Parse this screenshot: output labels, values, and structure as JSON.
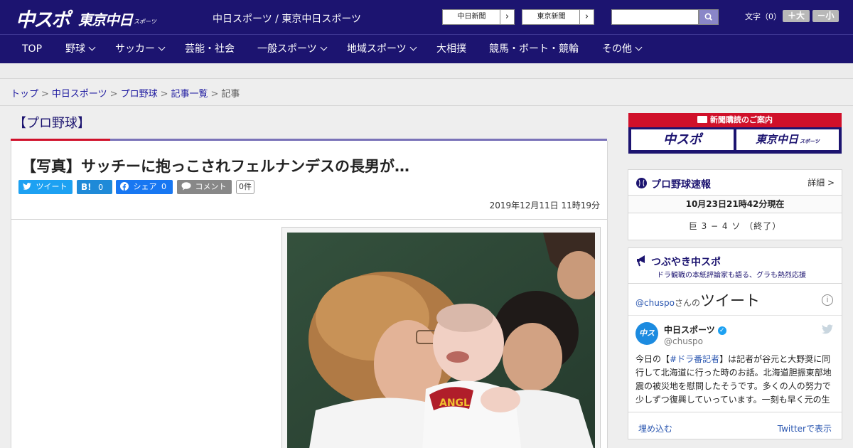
{
  "header": {
    "logo_chuspo": "中スポ",
    "logo_tokyo": "東京中日",
    "logo_tokyo_sub": "スポーツ",
    "site_name": "中日スポーツ / 東京中日スポーツ",
    "paper_links": [
      {
        "label": "中日新聞",
        "arrow": "›"
      },
      {
        "label": "東京新聞",
        "arrow": "›"
      }
    ],
    "search": {
      "placeholder": "",
      "icon": "search-icon"
    },
    "font_size": {
      "label": "文字（0）",
      "bigger": "＋大",
      "smaller": "－小"
    }
  },
  "nav": {
    "items": [
      {
        "label": "TOP",
        "has_menu": false
      },
      {
        "label": "野球",
        "has_menu": true
      },
      {
        "label": "サッカー",
        "has_menu": true
      },
      {
        "label": "芸能・社会",
        "has_menu": false
      },
      {
        "label": "一般スポーツ",
        "has_menu": true
      },
      {
        "label": "地域スポーツ",
        "has_menu": true
      },
      {
        "label": "大相撲",
        "has_menu": false
      },
      {
        "label": "競馬・ボート・競輪",
        "has_menu": false
      },
      {
        "label": "その他",
        "has_menu": true
      }
    ]
  },
  "breadcrumb": {
    "items": [
      "トップ",
      "中日スポーツ",
      "プロ野球",
      "記事一覧"
    ],
    "current": "記事",
    "separator": ">"
  },
  "section_title": "【プロ野球】",
  "article": {
    "title": "【写真】サッチーに抱っこされフェルナンデスの長男が…",
    "share": {
      "twitter": "ツイート",
      "hatena": "B!",
      "hatena_count": "0",
      "facebook": "シェア",
      "facebook_count": "0",
      "comment": "コメント",
      "comment_count": "0件"
    },
    "date": "2019年12月11日 11時19分",
    "photo_badge": "ANGL"
  },
  "sidebar": {
    "subscribe": {
      "heading": "新聞購読のご案内",
      "chuspo": "中スポ",
      "tokyo": "東京中日",
      "tokyo_sub": "スポーツ"
    },
    "scores": {
      "title": "プロ野球速報",
      "detail": "詳細 >",
      "time": "10月23日21時42分現在",
      "game": "巨 3 − 4 ソ （終了）"
    },
    "tweets": {
      "title": "つぶやき中スポ",
      "subtitle": "ドラ観戦の本紙評論家も語る、グラも熱烈応援",
      "handle": "@chuspo",
      "handle_suffix": "さんの",
      "heading": "ツイート",
      "info": "i",
      "account_name": "中日スポーツ",
      "account_user": "@chuspo",
      "avatar_text": "中スポ",
      "verified": "✓",
      "body_pre": "今日の【",
      "body_tag": "#ドラ番記者",
      "body_post": "】は記者が谷元と大野奨に同行して北海道に行った時のお話。北海道胆振東部地震の被災地を慰問したそうです。多くの人の努力で少しずつ復興していっています。一刻も早く元の生",
      "embed": "埋め込む",
      "view_on_twitter": "Twitterで表示"
    }
  },
  "colors": {
    "brand_navy": "#1c1470",
    "accent_red": "#d0102a",
    "twitter_blue": "#1da1f2",
    "facebook_blue": "#1877f2"
  }
}
